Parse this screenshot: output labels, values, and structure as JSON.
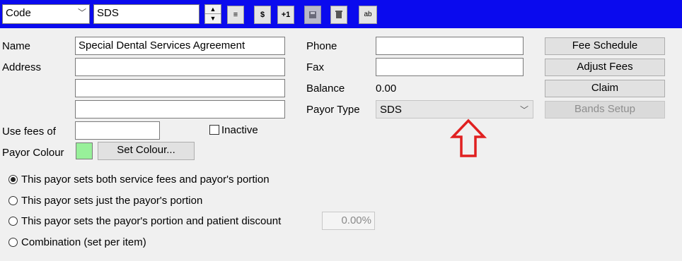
{
  "toolbar": {
    "code_select": "Code",
    "code_value": "SDS",
    "buttons": [
      "≡",
      "$",
      "+1",
      "",
      "",
      "ab"
    ]
  },
  "form": {
    "name_label": "Name",
    "name_value": "Special Dental Services Agreement",
    "address_label": "Address",
    "address_lines": [
      "",
      "",
      ""
    ],
    "use_fees_label": "Use fees of",
    "use_fees_value": "",
    "inactive_label": "Inactive",
    "inactive_checked": false,
    "payor_colour_label": "Payor Colour",
    "payor_colour": "#98f09a",
    "set_colour_label": "Set Colour...",
    "phone_label": "Phone",
    "phone_value": "",
    "fax_label": "Fax",
    "fax_value": "",
    "balance_label": "Balance",
    "balance_value": "0.00",
    "payor_type_label": "Payor Type",
    "payor_type_value": "SDS"
  },
  "side_buttons": {
    "fee_schedule": "Fee Schedule",
    "adjust_fees": "Adjust Fees",
    "claim": "Claim",
    "bands_setup": "Bands Setup"
  },
  "options": {
    "opt1": "This payor sets both service fees and payor's portion",
    "opt2": "This payor sets just the payor's portion",
    "opt3": "This payor sets the payor's portion and patient discount",
    "opt3_discount": "0.00%",
    "opt4": "Combination (set per item)",
    "selected_index": 0
  },
  "colors": {
    "toolbar_bg": "#0a0aee",
    "annotation_arrow": "#e02020"
  }
}
